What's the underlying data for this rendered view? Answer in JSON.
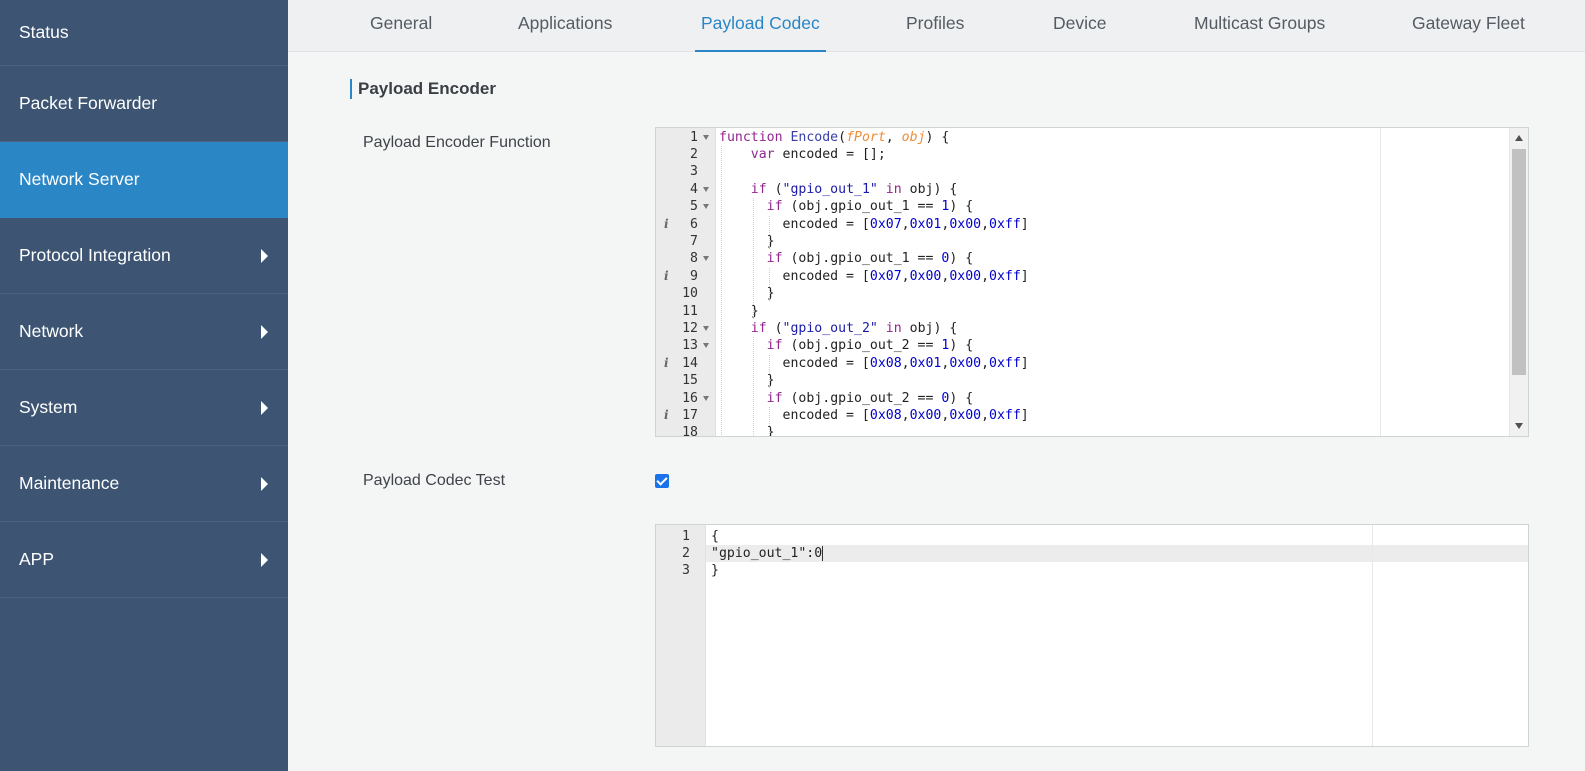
{
  "sidebar": {
    "items": [
      {
        "label": "Status",
        "has_submenu": false,
        "active": false
      },
      {
        "label": "Packet Forwarder",
        "has_submenu": false,
        "active": false
      },
      {
        "label": "Network Server",
        "has_submenu": false,
        "active": true
      },
      {
        "label": "Protocol Integration",
        "has_submenu": true,
        "active": false
      },
      {
        "label": "Network",
        "has_submenu": true,
        "active": false
      },
      {
        "label": "System",
        "has_submenu": true,
        "active": false
      },
      {
        "label": "Maintenance",
        "has_submenu": true,
        "active": false
      },
      {
        "label": "APP",
        "has_submenu": true,
        "active": false
      }
    ]
  },
  "tabs": {
    "items": [
      {
        "label": "General",
        "active": false
      },
      {
        "label": "Applications",
        "active": false
      },
      {
        "label": "Payload Codec",
        "active": true
      },
      {
        "label": "Profiles",
        "active": false
      },
      {
        "label": "Device",
        "active": false
      },
      {
        "label": "Multicast Groups",
        "active": false
      },
      {
        "label": "Gateway Fleet",
        "active": false
      }
    ]
  },
  "section": {
    "title": "Payload Encoder"
  },
  "encoder": {
    "label": "Payload Encoder Function",
    "code_lines": [
      "function Encode(fPort, obj) {",
      "    var encoded = [];",
      "",
      "    if (\"gpio_out_1\" in obj) {",
      "      if (obj.gpio_out_1 == 1) {",
      "        encoded = [0x07,0x01,0x00,0xff]",
      "      }",
      "      if (obj.gpio_out_1 == 0) {",
      "        encoded = [0x07,0x00,0x00,0xff]",
      "      }",
      "    }",
      "    if (\"gpio_out_2\" in obj) {",
      "      if (obj.gpio_out_2 == 1) {",
      "        encoded = [0x08,0x01,0x00,0xff]",
      "      }",
      "      if (obj.gpio_out_2 == 0) {",
      "        encoded = [0x08,0x00,0x00,0xff]",
      "      }"
    ],
    "fold_lines": [
      1,
      4,
      5,
      8,
      12,
      13,
      16
    ],
    "info_lines": [
      6,
      9,
      14,
      17
    ]
  },
  "codec_test": {
    "label": "Payload Codec Test",
    "checked": true,
    "code_lines": [
      "{",
      "\"gpio_out_1\":0",
      "}"
    ],
    "active_line": 2
  },
  "colors": {
    "sidebar_bg": "#3d5573",
    "sidebar_active": "#2b86c5",
    "accent": "#2b86c5",
    "checkbox": "#1a73e8"
  }
}
